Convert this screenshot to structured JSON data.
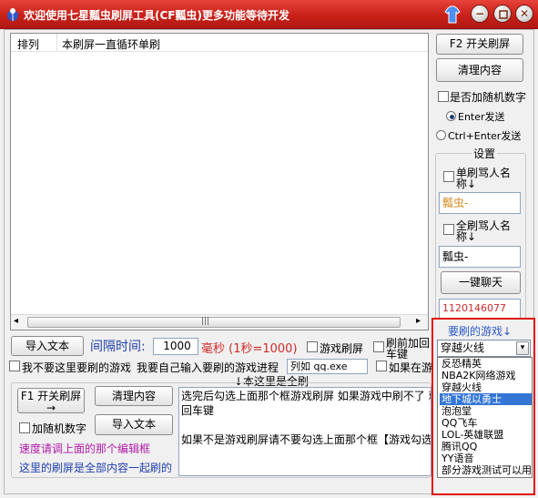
{
  "window": {
    "title": "欢迎使用七星瓢虫刷屏工具(CF瓢虫)更多功能等待开发",
    "min_label": "−",
    "close_label": "✕"
  },
  "list": {
    "col1": "排列",
    "col2": "本刷屏一直循环单刷"
  },
  "right_panel": {
    "f2_button": "F2 开关刷屏",
    "clear_button": "清理内容",
    "random_number_label": "是否加随机数字",
    "enter_send_label": "Enter发送",
    "ctrl_enter_send_label": "Ctrl+Enter发送",
    "settings_label": "设置",
    "single_abuse_label_1": "单刷骂人名",
    "single_abuse_label_2": "称↓",
    "name_field_1": "瓢虫-",
    "all_abuse_label_1": "全刷骂人名",
    "all_abuse_label_2": "称↓",
    "name_field_2": "瓢虫-",
    "chat_button": "一键聊天",
    "qq_field": "1120146077",
    "game_label": "要刷的游戏↓",
    "game_selected": "穿越火线",
    "game_options": [
      "反恐精英",
      "NBA2K网络游戏",
      "穿越火线",
      "地下城以勇士",
      "泡泡堂",
      "QQ飞车",
      "LOL-英雄联盟",
      "腾讯QQ",
      "YY语音",
      "部分游戏测试可以用"
    ],
    "game_highlighted_index": 3
  },
  "middle": {
    "import_button": "导入文本",
    "interval_label": "间隔时间:",
    "interval_value": "1000",
    "ms_label": "毫秒 (1秒=1000)",
    "game_spam_label": "游戏刷屏",
    "press_enter_label_1": "刷前加回",
    "press_enter_label_2": "车键",
    "not_game_label": "我不要这里要刷的游戏",
    "process_label": "我要自己输入要刷的游戏进程",
    "process_value": "列如 qq.exe",
    "if_in_game_label": "如果在游",
    "all_spam_label": "↓本这里是全刷"
  },
  "bottom": {
    "f1_button_1": "F1 开关刷屏",
    "f1_button_2": "→",
    "clear_button": "清理内容",
    "random_number_label": "加随机数字",
    "import_button": "导入文本",
    "speed_hint": "速度请调上面的那个编辑框",
    "all_content_hint": "这里的刷屏是全部内容一起刷的",
    "textarea_line1": "选完后勾选上面那个框游戏刷屏 如果游戏中刷不了 就勾选刷前加",
    "textarea_line2": "回车键",
    "textarea_line3": "",
    "textarea_line4": "如果不是游戏刷屏请不要勾选上面那个框【游戏勾选】"
  },
  "scrollbar": {
    "left_arrow": "◂",
    "right_arrow": "▸",
    "grip": "|||"
  },
  "colors": {
    "title_bar": "#c8211a",
    "highlight_border": "#e01010",
    "accent_blue": "#1f3fae",
    "accent_red": "#d02a2a",
    "purple_hint": "#b01aa8"
  }
}
